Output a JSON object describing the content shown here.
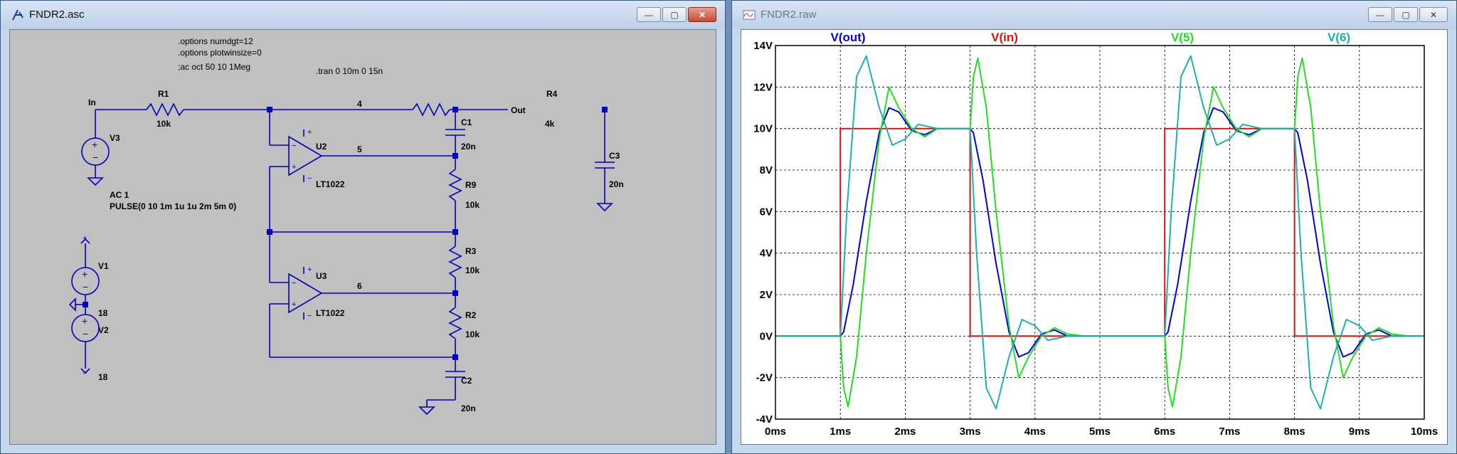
{
  "schematic_window": {
    "title": "FNDR2.asc",
    "directives": [
      ".options numdgt=12",
      ".options plotwinsize=0",
      ";ac oct 50 10 1Meg",
      ".tran 0 10m 0 15n"
    ],
    "nets": {
      "in": "In",
      "out": "Out",
      "n4": "4",
      "n5": "5",
      "n6": "6"
    },
    "components": {
      "R1": {
        "name": "R1",
        "value": "10k"
      },
      "R4": {
        "name": "R4",
        "value": "4k"
      },
      "C1": {
        "name": "C1",
        "value": "20n"
      },
      "C3": {
        "name": "C3",
        "value": "20n"
      },
      "R9": {
        "name": "R9",
        "value": "10k"
      },
      "R3": {
        "name": "R3",
        "value": "10k"
      },
      "R2": {
        "name": "R2",
        "value": "10k"
      },
      "C2": {
        "name": "C2",
        "value": "20n"
      },
      "U2": {
        "name": "U2",
        "value": "LT1022"
      },
      "U3": {
        "name": "U3",
        "value": "LT1022"
      },
      "V3": {
        "name": "V3",
        "value": "AC 1",
        "value2": "PULSE(0 10 1m 1u 1u 2m 5m 0)"
      },
      "V1": {
        "name": "V1",
        "value": "18"
      },
      "V2": {
        "name": "V2",
        "value": "18"
      }
    }
  },
  "waveform_window": {
    "title": "FNDR2.raw"
  },
  "window_buttons": {
    "minimize": "—",
    "restore": "▢",
    "close": "✕"
  },
  "colors": {
    "v_out": "#0000e0",
    "v_in": "#e01010",
    "v5": "#20e020",
    "v6": "#20b0b0",
    "wire": "#0000c0"
  },
  "chart_data": {
    "type": "line",
    "xlabel": "",
    "ylabel": "",
    "xlim": [
      0,
      10
    ],
    "ylim": [
      -4,
      14
    ],
    "x_ticks": [
      0,
      1,
      2,
      3,
      4,
      5,
      6,
      7,
      8,
      9,
      10
    ],
    "x_tick_labels": [
      "0ms",
      "1ms",
      "2ms",
      "3ms",
      "4ms",
      "5ms",
      "6ms",
      "7ms",
      "8ms",
      "9ms",
      "10ms"
    ],
    "y_ticks": [
      -4,
      -2,
      0,
      2,
      4,
      6,
      8,
      10,
      12,
      14
    ],
    "y_tick_labels": [
      "-4V",
      "-2V",
      "0V",
      "2V",
      "4V",
      "6V",
      "8V",
      "10V",
      "12V",
      "14V"
    ],
    "grid": true,
    "legend": "top",
    "series": [
      {
        "name": "V(out)",
        "color": "#0000e0",
        "x": [
          0,
          1,
          1.05,
          1.2,
          1.4,
          1.6,
          1.75,
          1.9,
          2.1,
          2.3,
          2.5,
          3,
          3.05,
          3.2,
          3.4,
          3.6,
          3.75,
          3.9,
          4.1,
          4.3,
          4.5,
          5,
          6,
          6.05,
          6.2,
          6.4,
          6.6,
          6.75,
          6.9,
          7.1,
          7.3,
          7.5,
          8,
          8.05,
          8.2,
          8.4,
          8.6,
          8.75,
          8.9,
          9.1,
          9.3,
          9.5,
          10
        ],
        "y": [
          0,
          0,
          0.2,
          2.5,
          6.5,
          9.8,
          11.0,
          10.8,
          9.9,
          9.7,
          10.0,
          10.0,
          9.8,
          7.5,
          3.5,
          0.2,
          -1.0,
          -0.8,
          0.1,
          0.3,
          0.0,
          0.0,
          0.0,
          0.2,
          2.5,
          6.5,
          9.8,
          11.0,
          10.8,
          9.9,
          9.7,
          10.0,
          10.0,
          9.8,
          7.5,
          3.5,
          0.2,
          -1.0,
          -0.8,
          0.1,
          0.3,
          0.0,
          0.0
        ]
      },
      {
        "name": "V(in)",
        "color": "#e01010",
        "x": [
          0,
          1,
          1,
          3,
          3,
          6,
          6,
          8,
          8,
          10
        ],
        "y": [
          0,
          0,
          10,
          10,
          0,
          0,
          10,
          10,
          0,
          0
        ]
      },
      {
        "name": "V(5)",
        "color": "#20e020",
        "x": [
          0,
          1,
          1.05,
          1.12,
          1.25,
          1.4,
          1.6,
          1.75,
          1.9,
          2.1,
          2.3,
          2.5,
          2.75,
          3,
          3.05,
          3.12,
          3.25,
          3.4,
          3.6,
          3.75,
          3.9,
          4.1,
          4.3,
          4.5,
          4.75,
          5,
          6,
          6.05,
          6.12,
          6.25,
          6.4,
          6.6,
          6.75,
          6.9,
          7.1,
          7.3,
          7.5,
          7.75,
          8,
          8.05,
          8.12,
          8.25,
          8.4,
          8.6,
          8.75,
          8.9,
          9.1,
          9.3,
          9.5,
          9.75,
          10
        ],
        "y": [
          0,
          0,
          -2.5,
          -3.4,
          -1.0,
          4.0,
          9.5,
          12.0,
          11.0,
          10.0,
          9.6,
          10.0,
          10.0,
          10.0,
          12.5,
          13.4,
          11.0,
          6.0,
          0.5,
          -2.0,
          -1.0,
          0.0,
          0.4,
          0.1,
          0.0,
          0.0,
          0.0,
          -2.5,
          -3.4,
          -1.0,
          4.0,
          9.5,
          12.0,
          11.0,
          10.0,
          9.6,
          10.0,
          10.0,
          10.0,
          12.5,
          13.4,
          11.0,
          6.0,
          0.5,
          -2.0,
          -1.0,
          0.0,
          0.4,
          0.1,
          0.0,
          0.0
        ]
      },
      {
        "name": "V(6)",
        "color": "#20b0b0",
        "x": [
          0,
          1,
          1.1,
          1.25,
          1.4,
          1.6,
          1.8,
          2.0,
          2.2,
          2.5,
          3,
          3.1,
          3.25,
          3.4,
          3.6,
          3.8,
          4.0,
          4.2,
          4.5,
          5,
          6,
          6.1,
          6.25,
          6.4,
          6.6,
          6.8,
          7.0,
          7.2,
          7.5,
          8,
          8.1,
          8.25,
          8.4,
          8.6,
          8.8,
          9.0,
          9.2,
          9.5,
          10
        ],
        "y": [
          0,
          0,
          6.0,
          12.5,
          13.5,
          11.0,
          9.2,
          9.5,
          10.2,
          10.0,
          10.0,
          4.0,
          -2.5,
          -3.5,
          -1.0,
          0.8,
          0.5,
          -0.2,
          0.0,
          0.0,
          0.0,
          6.0,
          12.5,
          13.5,
          11.0,
          9.2,
          9.5,
          10.2,
          10.0,
          10.0,
          4.0,
          -2.5,
          -3.5,
          -1.0,
          0.8,
          0.5,
          -0.2,
          0.0,
          0.0
        ]
      }
    ]
  }
}
